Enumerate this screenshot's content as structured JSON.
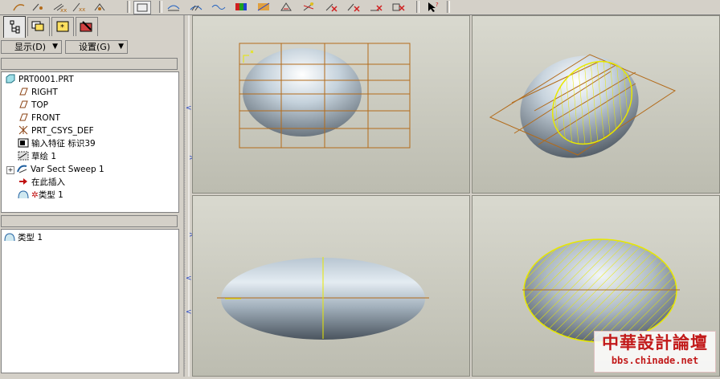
{
  "colors": {
    "ui_face": "#d4d0c8",
    "datum_plane": "#b36b1a",
    "sketch": "#e8e800",
    "watermark": "#c21a1a"
  },
  "toolbar": {
    "icons": [
      "datum-curve-icon",
      "datum-point-icon",
      "datum-plane-icon",
      "datum-axis-icon",
      "datum-csys-icon",
      "view-icon",
      "analysis-icon",
      "surface-analysis-icon",
      "curvature-icon",
      "shading-icon",
      "draft-check-icon",
      "section-icon",
      "reflection-icon",
      "hide-icon",
      "delete-icon",
      "select-arrow-icon"
    ]
  },
  "left_panel": {
    "tabs": [
      "model-tree-tab",
      "layers-tab",
      "favorites-tab",
      "tools-tab"
    ],
    "menu": {
      "display_label": "显示(D)",
      "settings_label": "设置(G)"
    },
    "tree": {
      "items": [
        {
          "label": "PRT0001.PRT",
          "icon": "part-icon"
        },
        {
          "label": "RIGHT",
          "icon": "datum-plane-icon"
        },
        {
          "label": "TOP",
          "icon": "datum-plane-icon"
        },
        {
          "label": "FRONT",
          "icon": "datum-plane-icon"
        },
        {
          "label": "PRT_CSYS_DEF",
          "icon": "csys-icon"
        },
        {
          "label": "输入特征 标识39",
          "icon": "import-feature-icon"
        },
        {
          "label": "草绘 1",
          "icon": "sketch-icon"
        },
        {
          "label": "Var Sect Sweep 1",
          "icon": "sweep-icon"
        },
        {
          "label": "在此插入",
          "icon": "insert-here-icon"
        },
        {
          "label": "类型 1",
          "icon": "surface-type-icon"
        }
      ]
    },
    "lower_list": {
      "items": [
        {
          "label": "类型 1",
          "icon": "surface-type-icon"
        }
      ]
    }
  },
  "watermark": {
    "title": "中華設計論壇",
    "url": "bbs.chinade.net"
  }
}
